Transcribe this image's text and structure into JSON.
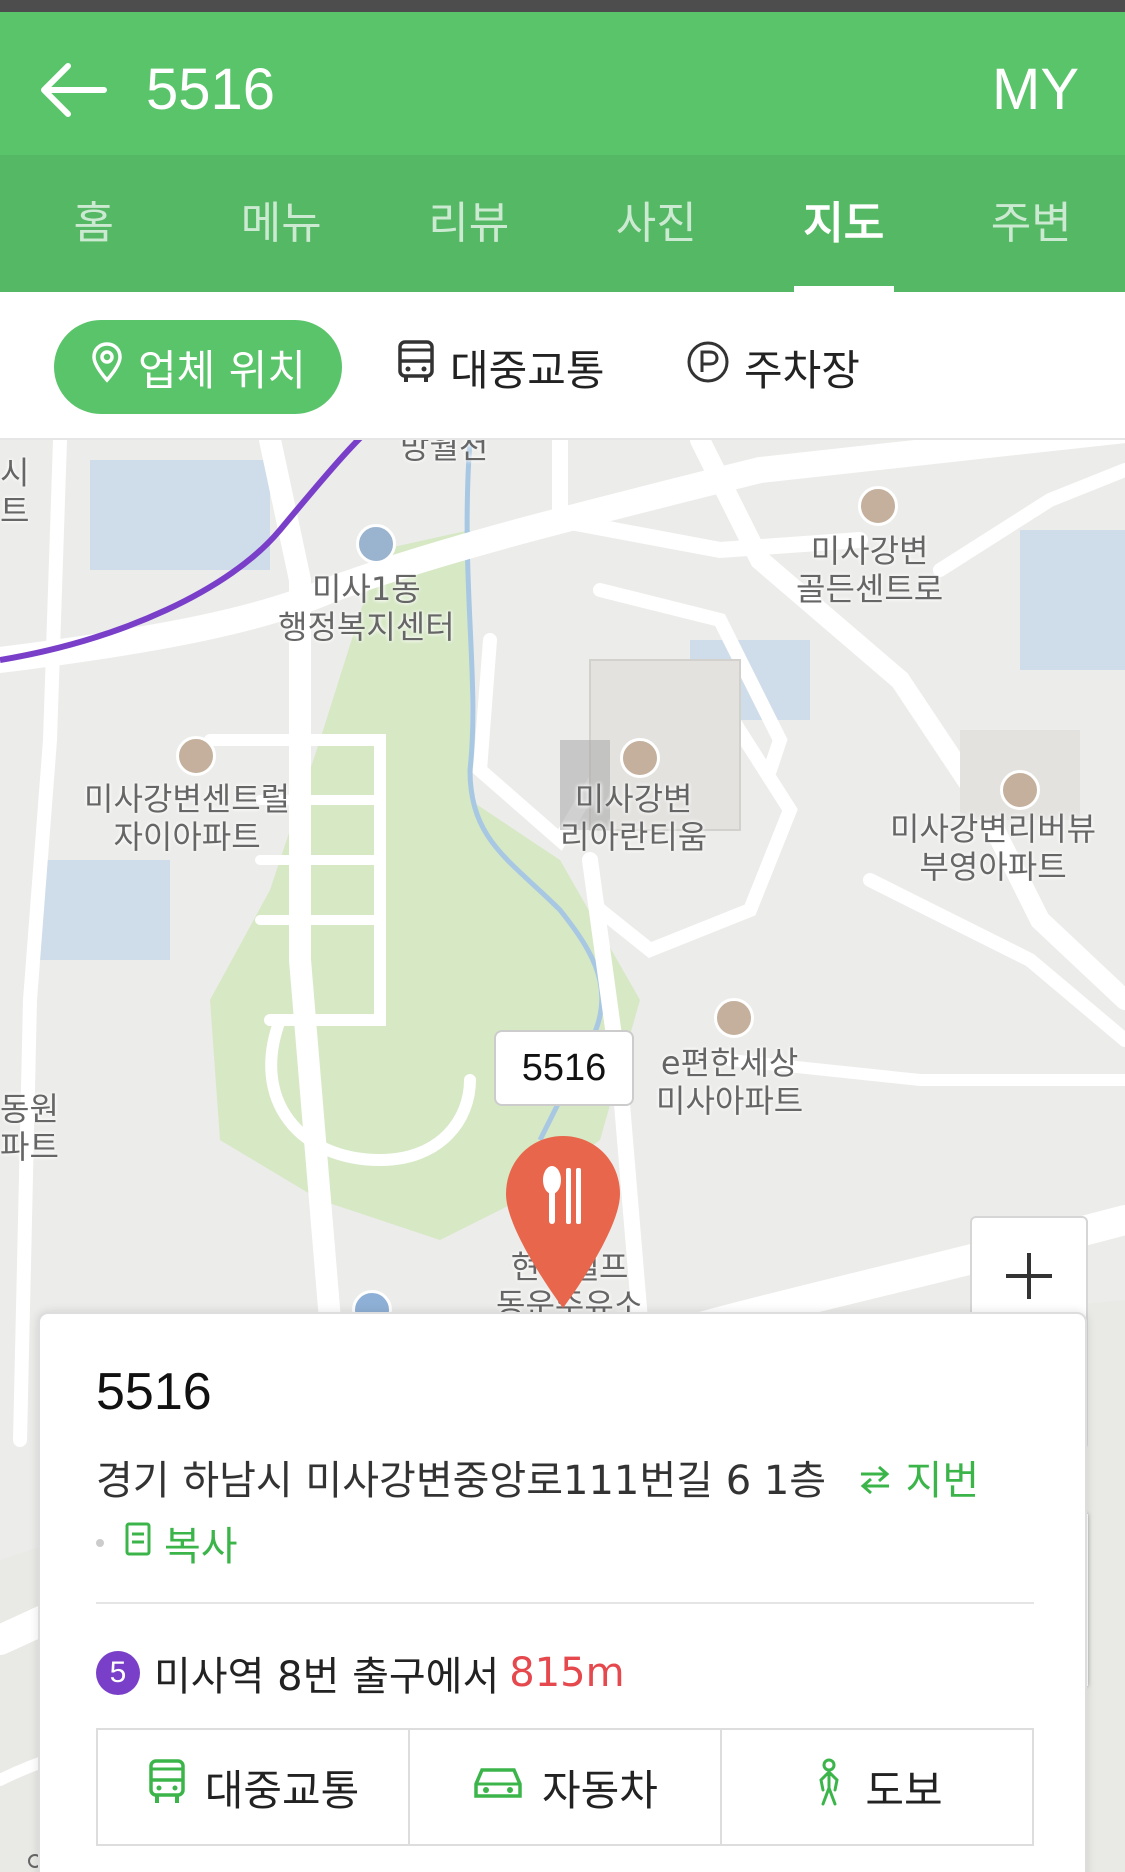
{
  "header": {
    "title": "5516",
    "my_label": "MY"
  },
  "tabs": [
    {
      "label": "홈"
    },
    {
      "label": "메뉴"
    },
    {
      "label": "리뷰"
    },
    {
      "label": "사진"
    },
    {
      "label": "지도",
      "active": true
    },
    {
      "label": "주변"
    }
  ],
  "filters": {
    "location": "업체 위치",
    "transit": "대중교통",
    "parking": "주차장"
  },
  "map": {
    "callout": "5516",
    "labels": {
      "l1": "미사강변\n골든센트로",
      "l2": "미사1동\n행정복지센터",
      "l3": "미사강변센트럴\n자이아파트",
      "l4": "미사강변\n리아란티움",
      "l5": "미사강변리버뷰\n부영아파트",
      "l6": "e편한세상\n미사아파트",
      "l7": "현대셀프\n동운주유소",
      "l8": "망월천",
      "edge1": "시\n트",
      "edge2": "동원\n파트"
    },
    "colors": {
      "accent": "#5ac46a",
      "subway_line": "#7a3fc9",
      "pin": "#e8674c"
    }
  },
  "card": {
    "title": "5516",
    "address": "경기 하남시 미사강변중앙로111번길 6 1층",
    "jibun_label": "지번",
    "copy_label": "복사",
    "line_number": "5",
    "station_text": "미사역 8번 출구에서",
    "distance": "815m",
    "routes": {
      "transit": "대중교통",
      "car": "자동차",
      "walk": "도보"
    }
  }
}
